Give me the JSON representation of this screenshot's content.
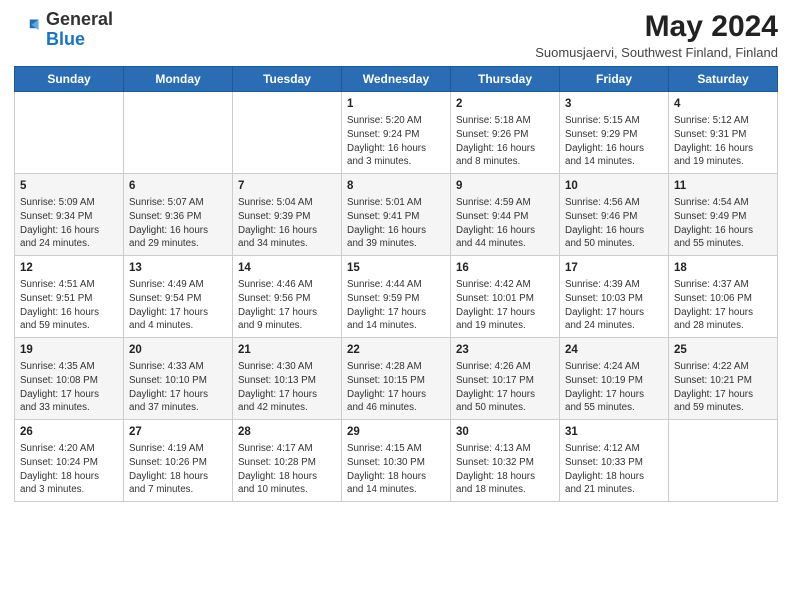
{
  "header": {
    "logo_general": "General",
    "logo_blue": "Blue",
    "month_year": "May 2024",
    "location": "Suomusjaervi, Southwest Finland, Finland"
  },
  "days_of_week": [
    "Sunday",
    "Monday",
    "Tuesday",
    "Wednesday",
    "Thursday",
    "Friday",
    "Saturday"
  ],
  "weeks": [
    [
      {
        "day": "",
        "info": ""
      },
      {
        "day": "",
        "info": ""
      },
      {
        "day": "",
        "info": ""
      },
      {
        "day": "1",
        "info": "Sunrise: 5:20 AM\nSunset: 9:24 PM\nDaylight: 16 hours and 3 minutes."
      },
      {
        "day": "2",
        "info": "Sunrise: 5:18 AM\nSunset: 9:26 PM\nDaylight: 16 hours and 8 minutes."
      },
      {
        "day": "3",
        "info": "Sunrise: 5:15 AM\nSunset: 9:29 PM\nDaylight: 16 hours and 14 minutes."
      },
      {
        "day": "4",
        "info": "Sunrise: 5:12 AM\nSunset: 9:31 PM\nDaylight: 16 hours and 19 minutes."
      }
    ],
    [
      {
        "day": "5",
        "info": "Sunrise: 5:09 AM\nSunset: 9:34 PM\nDaylight: 16 hours and 24 minutes."
      },
      {
        "day": "6",
        "info": "Sunrise: 5:07 AM\nSunset: 9:36 PM\nDaylight: 16 hours and 29 minutes."
      },
      {
        "day": "7",
        "info": "Sunrise: 5:04 AM\nSunset: 9:39 PM\nDaylight: 16 hours and 34 minutes."
      },
      {
        "day": "8",
        "info": "Sunrise: 5:01 AM\nSunset: 9:41 PM\nDaylight: 16 hours and 39 minutes."
      },
      {
        "day": "9",
        "info": "Sunrise: 4:59 AM\nSunset: 9:44 PM\nDaylight: 16 hours and 44 minutes."
      },
      {
        "day": "10",
        "info": "Sunrise: 4:56 AM\nSunset: 9:46 PM\nDaylight: 16 hours and 50 minutes."
      },
      {
        "day": "11",
        "info": "Sunrise: 4:54 AM\nSunset: 9:49 PM\nDaylight: 16 hours and 55 minutes."
      }
    ],
    [
      {
        "day": "12",
        "info": "Sunrise: 4:51 AM\nSunset: 9:51 PM\nDaylight: 16 hours and 59 minutes."
      },
      {
        "day": "13",
        "info": "Sunrise: 4:49 AM\nSunset: 9:54 PM\nDaylight: 17 hours and 4 minutes."
      },
      {
        "day": "14",
        "info": "Sunrise: 4:46 AM\nSunset: 9:56 PM\nDaylight: 17 hours and 9 minutes."
      },
      {
        "day": "15",
        "info": "Sunrise: 4:44 AM\nSunset: 9:59 PM\nDaylight: 17 hours and 14 minutes."
      },
      {
        "day": "16",
        "info": "Sunrise: 4:42 AM\nSunset: 10:01 PM\nDaylight: 17 hours and 19 minutes."
      },
      {
        "day": "17",
        "info": "Sunrise: 4:39 AM\nSunset: 10:03 PM\nDaylight: 17 hours and 24 minutes."
      },
      {
        "day": "18",
        "info": "Sunrise: 4:37 AM\nSunset: 10:06 PM\nDaylight: 17 hours and 28 minutes."
      }
    ],
    [
      {
        "day": "19",
        "info": "Sunrise: 4:35 AM\nSunset: 10:08 PM\nDaylight: 17 hours and 33 minutes."
      },
      {
        "day": "20",
        "info": "Sunrise: 4:33 AM\nSunset: 10:10 PM\nDaylight: 17 hours and 37 minutes."
      },
      {
        "day": "21",
        "info": "Sunrise: 4:30 AM\nSunset: 10:13 PM\nDaylight: 17 hours and 42 minutes."
      },
      {
        "day": "22",
        "info": "Sunrise: 4:28 AM\nSunset: 10:15 PM\nDaylight: 17 hours and 46 minutes."
      },
      {
        "day": "23",
        "info": "Sunrise: 4:26 AM\nSunset: 10:17 PM\nDaylight: 17 hours and 50 minutes."
      },
      {
        "day": "24",
        "info": "Sunrise: 4:24 AM\nSunset: 10:19 PM\nDaylight: 17 hours and 55 minutes."
      },
      {
        "day": "25",
        "info": "Sunrise: 4:22 AM\nSunset: 10:21 PM\nDaylight: 17 hours and 59 minutes."
      }
    ],
    [
      {
        "day": "26",
        "info": "Sunrise: 4:20 AM\nSunset: 10:24 PM\nDaylight: 18 hours and 3 minutes."
      },
      {
        "day": "27",
        "info": "Sunrise: 4:19 AM\nSunset: 10:26 PM\nDaylight: 18 hours and 7 minutes."
      },
      {
        "day": "28",
        "info": "Sunrise: 4:17 AM\nSunset: 10:28 PM\nDaylight: 18 hours and 10 minutes."
      },
      {
        "day": "29",
        "info": "Sunrise: 4:15 AM\nSunset: 10:30 PM\nDaylight: 18 hours and 14 minutes."
      },
      {
        "day": "30",
        "info": "Sunrise: 4:13 AM\nSunset: 10:32 PM\nDaylight: 18 hours and 18 minutes."
      },
      {
        "day": "31",
        "info": "Sunrise: 4:12 AM\nSunset: 10:33 PM\nDaylight: 18 hours and 21 minutes."
      },
      {
        "day": "",
        "info": ""
      }
    ]
  ]
}
